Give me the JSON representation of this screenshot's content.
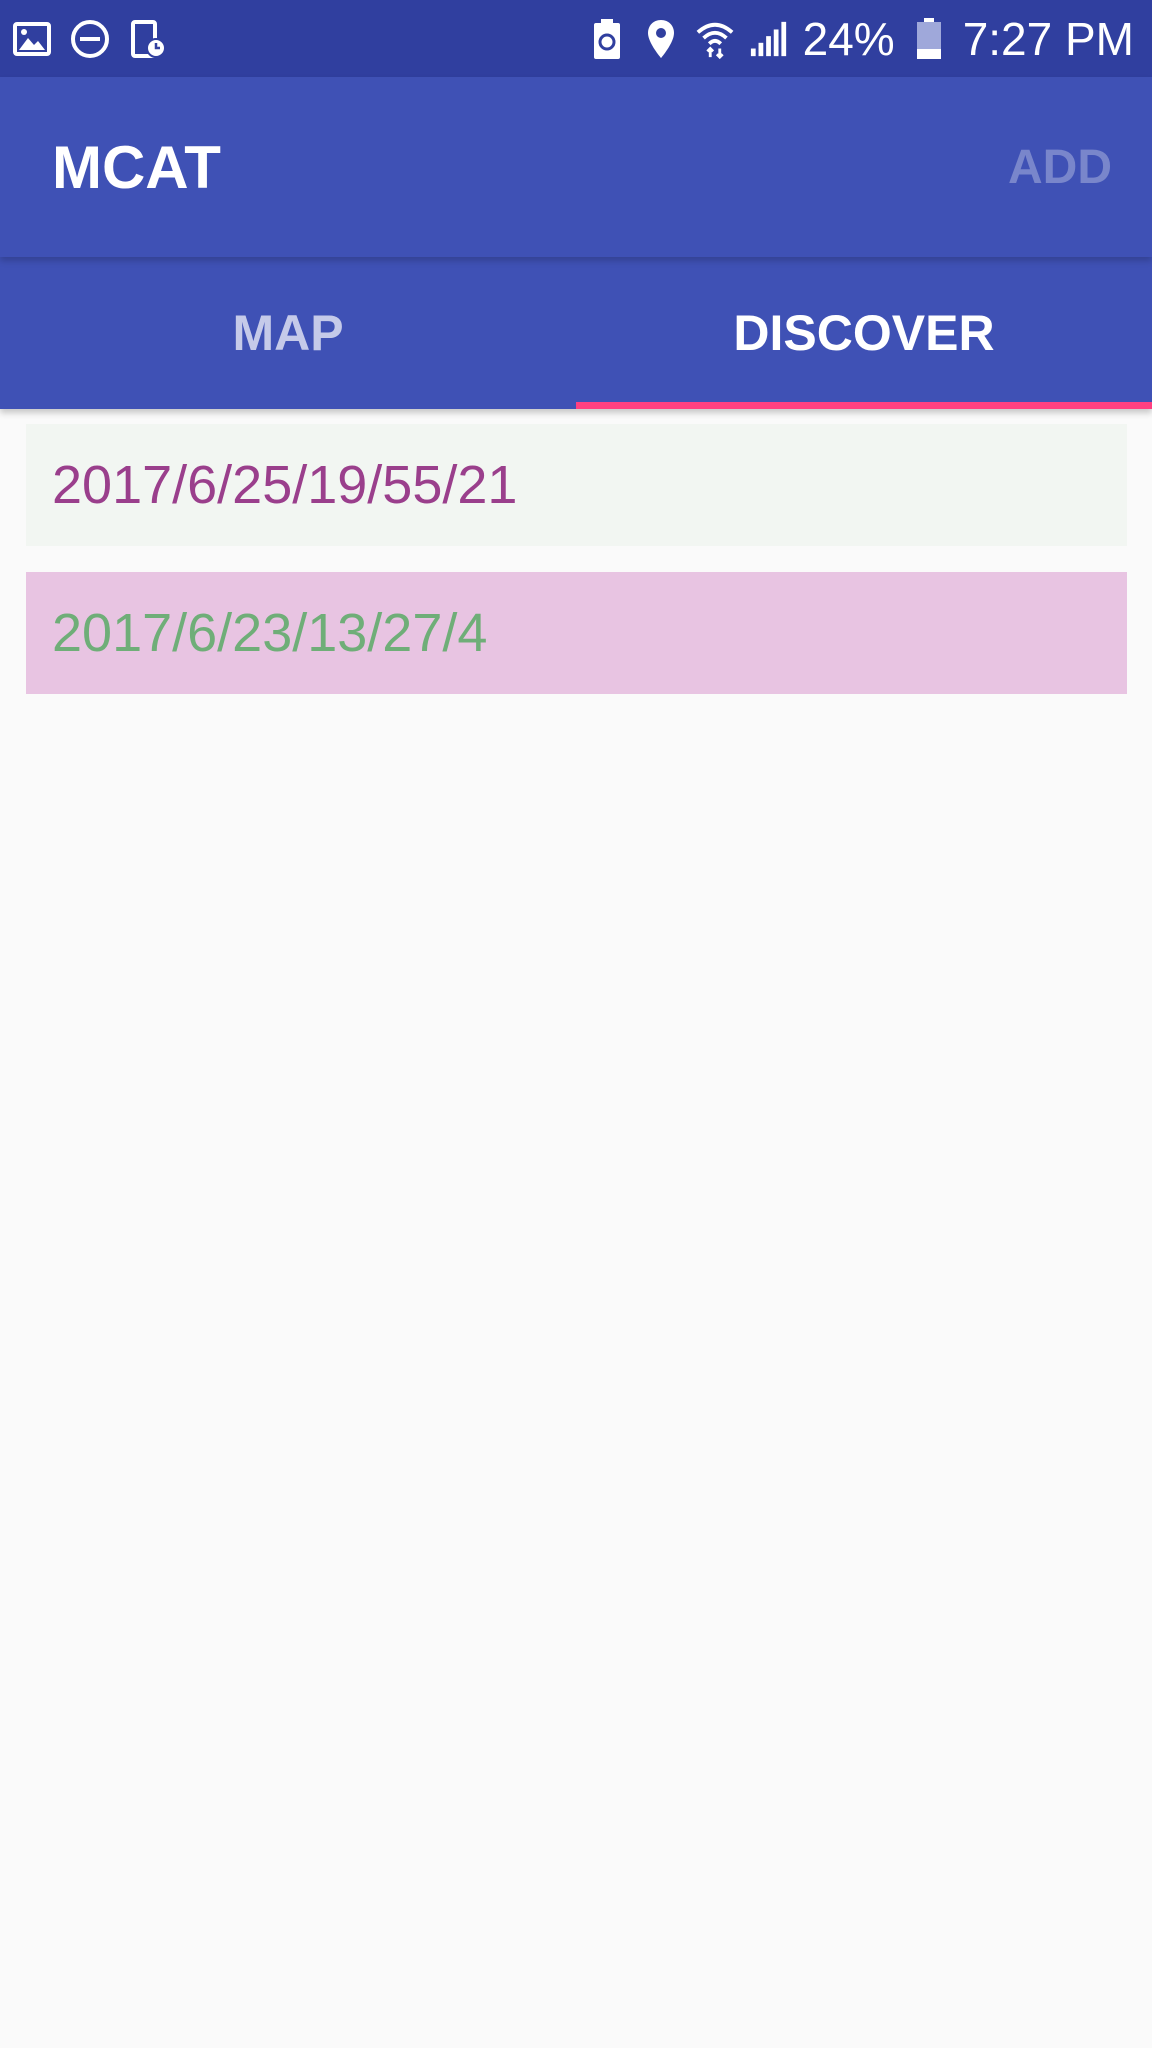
{
  "status_bar": {
    "left_icons": [
      "image-icon",
      "do-not-disturb-icon",
      "screen-timer-icon"
    ],
    "right_icons": [
      "battery-saver-icon",
      "location-icon",
      "wifi-icon",
      "signal-icon"
    ],
    "battery_percent": "24%",
    "time": "7:27 PM",
    "background": "#303f9f"
  },
  "app_bar": {
    "title": "MCAT",
    "action_label": "ADD",
    "background": "#3f51b5",
    "action_color": "#7986cb"
  },
  "tabs": [
    {
      "label": "MAP",
      "active": false
    },
    {
      "label": "DISCOVER",
      "active": true
    }
  ],
  "tab_indicator_color": "#ff4081",
  "entries": [
    {
      "text": "2017/6/25/19/55/21",
      "background": "#f2f6f2",
      "text_color": "#9a3f8c"
    },
    {
      "text": "2017/6/23/13/27/4",
      "background": "#e8c4e2",
      "text_color": "#6fae78"
    }
  ]
}
